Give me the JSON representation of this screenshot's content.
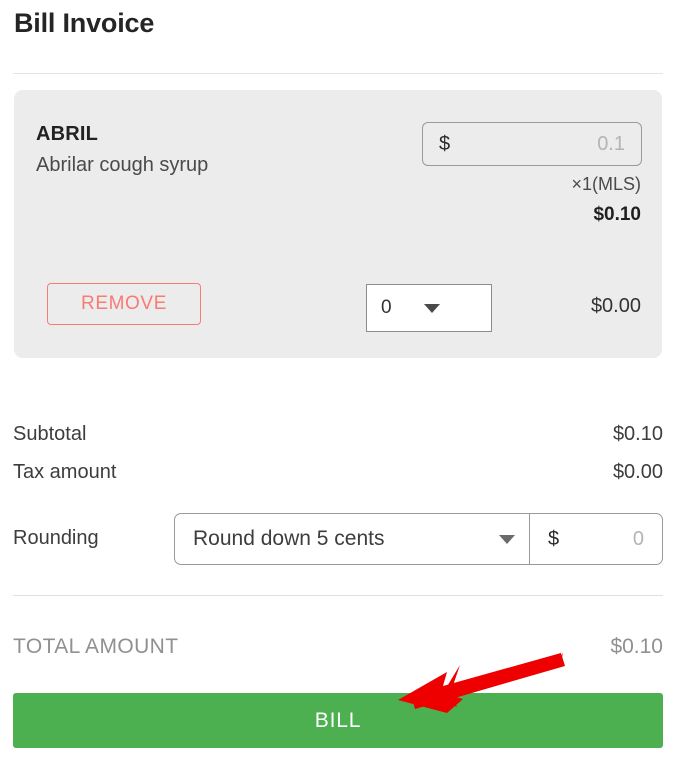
{
  "header": {
    "title": "Bill Invoice"
  },
  "item": {
    "name": "ABRIL",
    "description": "Abrilar cough syrup",
    "price_currency": "$",
    "price_value": "0.1",
    "qty_unit": "×1(MLS)",
    "line_total": "$0.10",
    "remove_label": "REMOVE",
    "qty_value": "0",
    "row_total": "$0.00"
  },
  "totals": {
    "subtotal_label": "Subtotal",
    "subtotal_value": "$0.10",
    "tax_label": "Tax amount",
    "tax_value": "$0.00"
  },
  "rounding": {
    "label": "Rounding",
    "mode": "Round down 5 cents",
    "currency": "$",
    "amount": "0"
  },
  "grand_total": {
    "label": "TOTAL AMOUNT",
    "value": "$0.10"
  },
  "actions": {
    "bill_label": "BILL"
  },
  "colors": {
    "primary_green": "#4CAF50",
    "remove_red": "#F97B73",
    "card_bg": "#ECECEC",
    "annotation_red": "#EE0000"
  }
}
